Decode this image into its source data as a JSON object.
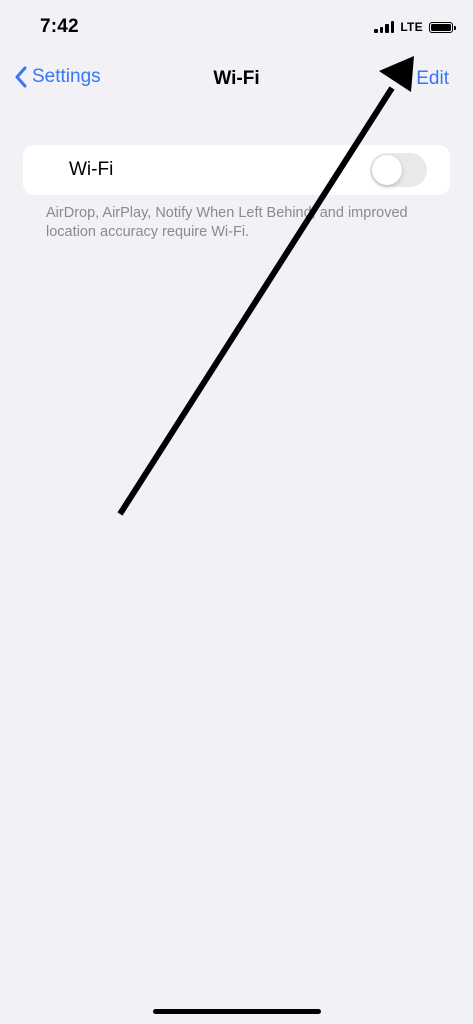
{
  "status_bar": {
    "time": "7:42",
    "network": "LTE",
    "signal_bars_filled": 4,
    "battery_level": 1.0
  },
  "nav": {
    "back_label": "Settings",
    "title": "Wi-Fi",
    "edit_label": "Edit"
  },
  "wifi_cell": {
    "label": "Wi-Fi",
    "toggle_on": false
  },
  "footer": {
    "text": "AirDrop, AirPlay, Notify When Left Behind, and improved location accuracy require Wi-Fi."
  },
  "colors": {
    "accent": "#3478f6",
    "background": "#f2f1f6",
    "secondary_text": "#8a8a8f",
    "toggle_off": "#e9e9ea"
  }
}
